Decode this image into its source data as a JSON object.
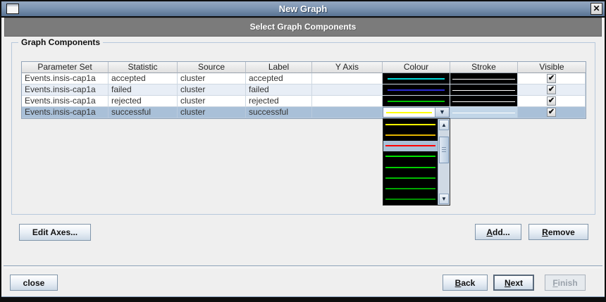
{
  "window": {
    "title": "New Graph"
  },
  "wizard": {
    "step_title": "Select Graph Components"
  },
  "group": {
    "title": "Graph Components"
  },
  "table": {
    "columns": [
      "Parameter Set",
      "Statistic",
      "Source",
      "Label",
      "Y Axis",
      "Colour",
      "Stroke",
      "Visible"
    ],
    "rows": [
      {
        "parameter_set": "Events.insis-cap1a",
        "statistic": "accepted",
        "source": "cluster",
        "label": "accepted",
        "y_axis": "",
        "colour_line": "#00d9d9",
        "colour_bg": "#000000",
        "stroke_line": "#ffffff",
        "stroke_bg": "#000000",
        "visible": true,
        "selected": false
      },
      {
        "parameter_set": "Events.insis-cap1a",
        "statistic": "failed",
        "source": "cluster",
        "label": "failed",
        "y_axis": "",
        "colour_line": "#2b2bd4",
        "colour_bg": "#000000",
        "stroke_line": "#ffffff",
        "stroke_bg": "#000000",
        "visible": true,
        "selected": false
      },
      {
        "parameter_set": "Events.insis-cap1a",
        "statistic": "rejected",
        "source": "cluster",
        "label": "rejected",
        "y_axis": "",
        "colour_line": "#00c400",
        "colour_bg": "#000000",
        "stroke_line": "#ffffff",
        "stroke_bg": "#000000",
        "visible": true,
        "selected": false
      },
      {
        "parameter_set": "Events.insis-cap1a",
        "statistic": "successful",
        "source": "cluster",
        "label": "successful",
        "y_axis": "",
        "colour_line": "#ffff00",
        "colour_bg": "#ffffff",
        "stroke_line": "#ffffff",
        "stroke_bg": "#c2d6e8",
        "visible": true,
        "selected": true,
        "editing_colour": true
      }
    ]
  },
  "colour_dropdown": {
    "open": true,
    "editor_value": "#ffff00",
    "selected_index": 2,
    "items": [
      {
        "color": "#ffff00",
        "selected": false
      },
      {
        "color": "#e3b400",
        "selected": false
      },
      {
        "color": "#ff0000",
        "selected": true
      },
      {
        "color": "#00e400",
        "selected": false
      },
      {
        "color": "#00d000",
        "selected": false
      },
      {
        "color": "#00bc00",
        "selected": false
      },
      {
        "color": "#00a800",
        "selected": false
      },
      {
        "color": "#009400",
        "selected": false
      }
    ]
  },
  "buttons": {
    "edit_axes": {
      "label": "Edit Axes..."
    },
    "add": {
      "pre": "",
      "mnemonic": "A",
      "post": "dd..."
    },
    "remove": {
      "pre": "",
      "mnemonic": "R",
      "post": "emove"
    },
    "close": {
      "label": "close"
    },
    "back": {
      "pre": "",
      "mnemonic": "B",
      "post": "ack"
    },
    "next": {
      "pre": "",
      "mnemonic": "N",
      "post": "ext",
      "focused": true
    },
    "finish": {
      "pre": "",
      "mnemonic": "F",
      "post": "inish",
      "disabled": true
    }
  },
  "icons": {
    "close": "✕",
    "check": "✔",
    "combo_arrow": "▼",
    "scroll_up": "▲",
    "scroll_down": "▼"
  },
  "colors": {
    "titlebar_top": "#94a8c1",
    "titlebar_bottom": "#587292",
    "step_band": "#7b7b7b",
    "selection_row": "#a9c0d8",
    "row_stripe": "#e8eef6",
    "swatch_background": "#000000"
  }
}
